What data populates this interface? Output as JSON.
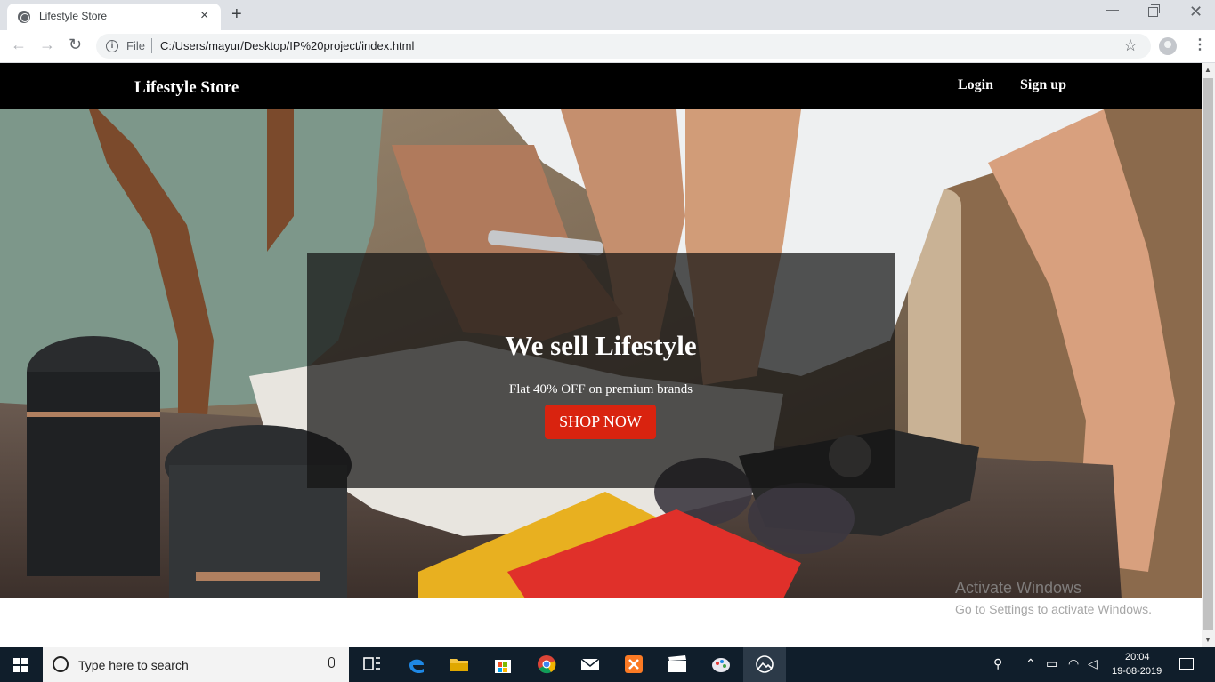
{
  "browser": {
    "tab_title": "Lifestyle Store",
    "new_tab_label": "+",
    "omnibox_scheme": "File",
    "url": "C:/Users/mayur/Desktop/IP%20project/index.html"
  },
  "site": {
    "brand": "Lifestyle Store",
    "nav": {
      "login": "Login",
      "signup": "Sign up"
    },
    "banner": {
      "title": "We sell Lifestyle",
      "subtitle": "Flat 40% OFF on premium brands",
      "cta": "SHOP NOW"
    },
    "colors": {
      "navbar": "#000000",
      "cta": "#d9230f"
    }
  },
  "watermark": {
    "line1": "Activate Windows",
    "line2": "Go to Settings to activate Windows."
  },
  "taskbar": {
    "search_placeholder": "Type here to search",
    "time": "20:04",
    "date": "19-08-2019",
    "pinned_icons": [
      "task-view-icon",
      "edge-icon",
      "file-explorer-icon",
      "store-icon",
      "chrome-icon",
      "mail-icon",
      "xampp-icon",
      "video-editor-icon",
      "paint-icon",
      "photos-icon"
    ]
  }
}
